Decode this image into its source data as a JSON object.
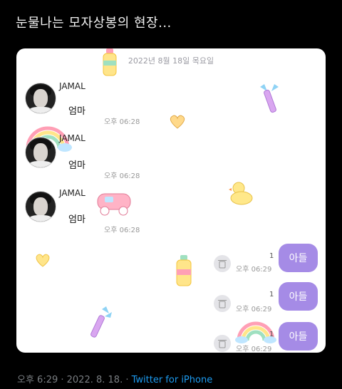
{
  "tweet": {
    "text": "눈물나는 모자상봉의 현장..."
  },
  "chat": {
    "date": "2022년 8월 18일 목요일",
    "incoming": [
      {
        "name": "JAMAL",
        "text": "엄마",
        "time": "오후 06:28"
      },
      {
        "name": "JAMAL",
        "text": "엄마",
        "time": "오후 06:28"
      },
      {
        "name": "JAMAL",
        "text": "엄마",
        "time": "오후 06:28"
      }
    ],
    "outgoing": [
      {
        "text": "아들",
        "time": "오후 06:29",
        "unread": "1"
      },
      {
        "text": "아들",
        "time": "오후 06:29",
        "unread": "1"
      },
      {
        "text": "아들",
        "time": "오후 06:29",
        "unread": "1"
      }
    ],
    "colors": {
      "bubble": "#a58be6",
      "background": "#ffffff"
    }
  },
  "footer": {
    "timestamp": "오후 6:29 · 2022. 8. 18. · ",
    "source": "Twitter for iPhone"
  }
}
